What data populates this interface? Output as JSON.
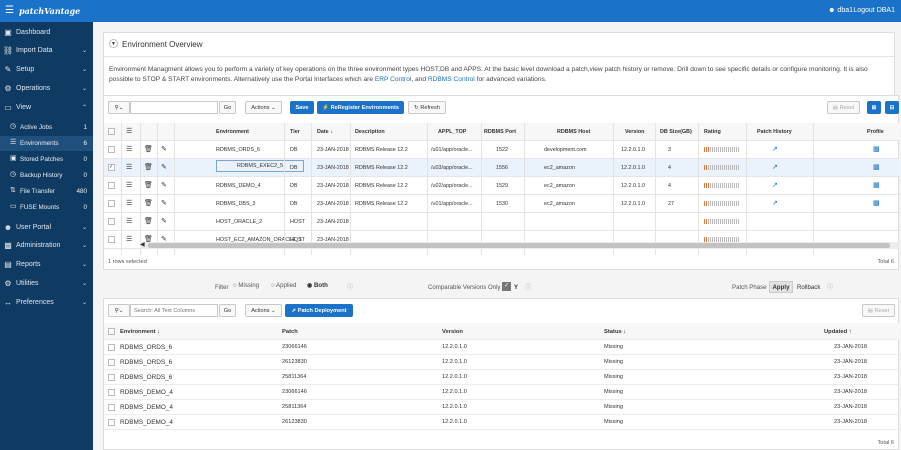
{
  "app": {
    "logo": "patchVantage",
    "user": "dba1",
    "logout": "Logout DBA1"
  },
  "sidebar": {
    "items": [
      {
        "label": "Dashboard",
        "icon": "dashboard-icon"
      },
      {
        "label": "Import Data",
        "icon": "database-icon"
      },
      {
        "label": "Setup",
        "icon": "edit-icon"
      },
      {
        "label": "Operations",
        "icon": "gear-icon"
      },
      {
        "label": "View",
        "icon": "monitor-icon"
      },
      {
        "label": "User Portal",
        "icon": "user-icon"
      },
      {
        "label": "Administration",
        "icon": "briefcase-icon"
      },
      {
        "label": "Reports",
        "icon": "chart-icon"
      },
      {
        "label": "Utilities",
        "icon": "gear-icon"
      },
      {
        "label": "Preferences",
        "icon": "arrows-icon"
      }
    ],
    "view_sub": [
      {
        "label": "Active Jobs",
        "count": "1"
      },
      {
        "label": "Environments",
        "count": "6"
      },
      {
        "label": "Stored Patches",
        "count": "0"
      },
      {
        "label": "Backup History",
        "count": "0"
      },
      {
        "label": "File Transfer",
        "count": "480"
      },
      {
        "label": "FUSE Mounts",
        "count": "0"
      }
    ]
  },
  "overview": {
    "title": "Environment Overview",
    "desc1": "Environment Managment allows you to perform a variety of key operations on the three environment types HOST,DB and APPS. At the basic level download a patch,view patch history or remove. Drill down to see specific details or configure monitoring. It is also",
    "desc2a": "possible to STOP & START environments. Alternatively use the Portal Interfaces which are ",
    "link1": "ERP Control",
    "desc2b": ", and ",
    "link2": "RDBMS Control",
    "desc2c": " for advanced variations."
  },
  "toolbar": {
    "go": "Go",
    "actions": "Actions",
    "save": "Save",
    "reregister": "ReRegister Environments",
    "refresh": "Refresh",
    "reset": "Reset"
  },
  "env_table": {
    "headers": [
      "Environment",
      "Tier",
      "Date",
      "Description",
      "APPL_TOP",
      "RDBMS Port",
      "RDBMS Host",
      "Version",
      "DB Size(GB)",
      "Rating",
      "Patch History",
      "Profile"
    ],
    "rows": [
      {
        "env": "RDBMS_ORDS_6",
        "tier": "DB",
        "date": "23-JAN-2018",
        "desc": "RDBMS Release 12.2",
        "appl": "/u01/app/oracle...",
        "port": "1522",
        "host": "development.com",
        "version": "12.2.0.1.0",
        "size": "3",
        "rating": 3
      },
      {
        "env": "RDBMS_EXEC2_5",
        "tier": "DB",
        "date": "23-JAN-2018",
        "desc": "RDBMS Release 12.2",
        "appl": "/u03/app/oracle...",
        "port": "1556",
        "host": "ec2_amazon",
        "version": "12.2.0.1.0",
        "size": "4",
        "rating": 2
      },
      {
        "env": "RDBMS_DEMO_4",
        "tier": "DB",
        "date": "23-JAN-2018",
        "desc": "RDBMS Release 12.2",
        "appl": "/u02/app/oracle...",
        "port": "1529",
        "host": "ec2_amazon",
        "version": "12.2.0.1.0",
        "size": "4",
        "rating": 3
      },
      {
        "env": "RDBMS_DBS_3",
        "tier": "DB",
        "date": "23-JAN-2018",
        "desc": "RDBMS Release 12.2",
        "appl": "/u01/app/oracle...",
        "port": "1530",
        "host": "ec2_amazon",
        "version": "12.2.0.1.0",
        "size": "27",
        "rating": 2
      },
      {
        "env": "HOST_ORACLE_2",
        "tier": "HOST",
        "date": "23-JAN-2018",
        "desc": "",
        "appl": "",
        "port": "",
        "host": "",
        "version": "",
        "size": "",
        "rating": 2
      },
      {
        "env": "HOST_EC2_AMAZON_ORACLE_1",
        "tier": "HOST",
        "date": "23-JAN-2018",
        "desc": "",
        "appl": "",
        "port": "",
        "host": "",
        "version": "",
        "size": "",
        "rating": 2
      }
    ],
    "rows_selected": "1 rows selected",
    "total": "Total 6"
  },
  "filter": {
    "label": "Filter",
    "missing": "Missing",
    "applied": "Applied",
    "both": "Both",
    "comparable": "Comparable Versions Only",
    "y": "Y",
    "patch_phase": "Patch Phase",
    "apply": "Apply",
    "rollback": "Rollback"
  },
  "lower": {
    "search_placeholder": "Search: All Text Columns",
    "go": "Go",
    "actions": "Actions",
    "deploy": "Patch Deployment",
    "reset": "Reset",
    "headers": [
      "Environment",
      "Patch",
      "Version",
      "Status",
      "Updated"
    ],
    "rows": [
      {
        "env": "RDBMS_ORDS_6",
        "patch": "23066146",
        "version": "12.2.0.1.0",
        "status": "Missing",
        "updated": "23-JAN-2018"
      },
      {
        "env": "RDBMS_ORDS_6",
        "patch": "26123830",
        "version": "12.2.0.1.0",
        "status": "Missing",
        "updated": "23-JAN-2018"
      },
      {
        "env": "RDBMS_ORDS_6",
        "patch": "25811364",
        "version": "12.2.0.1.0",
        "status": "Missing",
        "updated": "23-JAN-2018"
      },
      {
        "env": "RDBMS_DEMO_4",
        "patch": "23066146",
        "version": "12.2.0.1.0",
        "status": "Missing",
        "updated": "23-JAN-2018"
      },
      {
        "env": "RDBMS_DEMO_4",
        "patch": "25811364",
        "version": "12.2.0.1.0",
        "status": "Missing",
        "updated": "23-JAN-2018"
      },
      {
        "env": "RDBMS_DEMO_4",
        "patch": "26123830",
        "version": "12.2.0.1.0",
        "status": "Missing",
        "updated": "23-JAN-2018"
      }
    ],
    "total": "Total 6"
  },
  "colors": {
    "accent": "#1a73c8",
    "sidebar": "#0f3b63",
    "rating_low": "#e07a3f"
  }
}
